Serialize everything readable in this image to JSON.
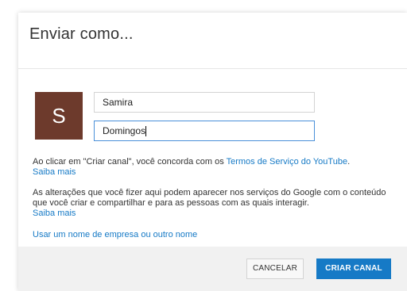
{
  "dialog": {
    "title": "Enviar como..."
  },
  "avatar": {
    "initial": "S",
    "color": "#6d3a2c"
  },
  "form": {
    "first_name": "Samira",
    "last_name": "Domingos"
  },
  "legal": {
    "p1_text": "Ao clicar em \"Criar canal\", você concorda com os ",
    "tos_link": "Termos de Serviço do YouTube",
    "p1_end": ".",
    "learn_more_1": "Saiba mais",
    "p2_text": "As alterações que você fizer aqui podem aparecer nos serviços do Google com o conteúdo que você criar e compartilhar e para as pessoas com as quais interagir.",
    "learn_more_2": "Saiba mais"
  },
  "other_name_link": "Usar um nome de empresa ou outro nome",
  "buttons": {
    "cancel": "CANCELAR",
    "create": "CRIAR CANAL"
  },
  "colors": {
    "link": "#167ac6",
    "primary": "#167ac6",
    "focus_border": "#4a90d9"
  }
}
